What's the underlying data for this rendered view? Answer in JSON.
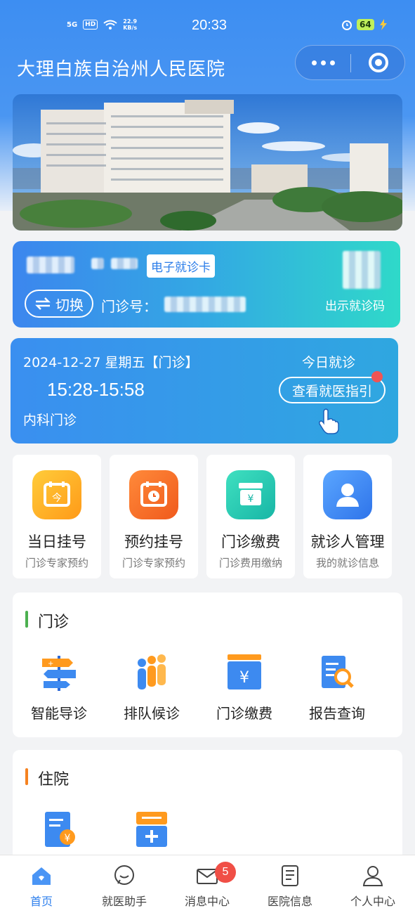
{
  "status_bar": {
    "signal": "5G",
    "hd": "HD",
    "speed_value": "22.9",
    "speed_unit": "KB/s",
    "time": "20:33",
    "battery": "64"
  },
  "header": {
    "title": "大理白族自治州人民医院"
  },
  "patient_card": {
    "ecard_badge": "电子就诊卡",
    "switch_label": "切换",
    "visit_no_label": "门诊号：",
    "qr_hint": "出示就诊码"
  },
  "appointment": {
    "date": "2024-12-27 星期五【门诊】",
    "today_label": "今日就诊",
    "time_range": "15:28-15:58",
    "guide_button": "查看就医指引",
    "department": "内科门诊"
  },
  "quick_actions": [
    {
      "label": "当日挂号",
      "sub": "门诊专家预约"
    },
    {
      "label": "预约挂号",
      "sub": "门诊专家预约"
    },
    {
      "label": "门诊缴费",
      "sub": "门诊费用缴纳"
    },
    {
      "label": "就诊人管理",
      "sub": "我的就诊信息"
    }
  ],
  "outpatient": {
    "title": "门诊",
    "items": [
      {
        "label": "智能导诊"
      },
      {
        "label": "排队候诊"
      },
      {
        "label": "门诊缴费"
      },
      {
        "label": "报告查询"
      }
    ]
  },
  "inpatient": {
    "title": "住院"
  },
  "tabbar": {
    "items": [
      {
        "label": "首页"
      },
      {
        "label": "就医助手"
      },
      {
        "label": "消息中心"
      },
      {
        "label": "医院信息"
      },
      {
        "label": "个人中心"
      }
    ],
    "message_badge": "5"
  },
  "colors": {
    "primary": "#2f80ed",
    "accent_green": "#4cb050",
    "accent_orange": "#f58220"
  }
}
